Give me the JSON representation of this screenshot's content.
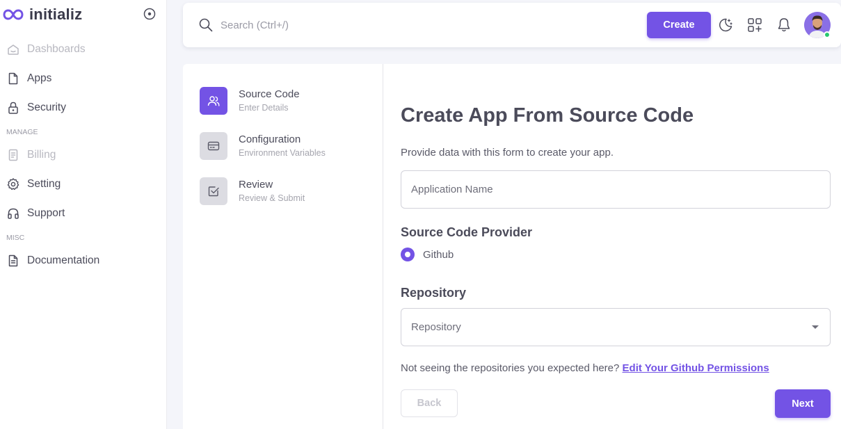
{
  "brand": {
    "name": "initializ",
    "accent": "#7353e5",
    "logo_icon": "infinity-icon"
  },
  "sidebar": {
    "items": [
      {
        "label": "Dashboards",
        "icon": "smart-home-icon",
        "disabled": true
      },
      {
        "label": "Apps",
        "icon": "file-icon",
        "disabled": false
      },
      {
        "label": "Security",
        "icon": "lock-icon",
        "disabled": false
      }
    ],
    "sections": [
      {
        "title": "MANAGE",
        "items": [
          {
            "label": "Billing",
            "icon": "file-dollar-icon",
            "disabled": true
          },
          {
            "label": "Setting",
            "icon": "gear-icon",
            "disabled": false
          },
          {
            "label": "Support",
            "icon": "headphones-icon",
            "disabled": false
          }
        ]
      },
      {
        "title": "MISC",
        "items": [
          {
            "label": "Documentation",
            "icon": "file-text-icon",
            "disabled": false
          }
        ]
      }
    ]
  },
  "header": {
    "search_placeholder": "Search (Ctrl+/)",
    "create_label": "Create",
    "icons": [
      "moon-stars-icon",
      "apps-plus-icon",
      "bell-icon"
    ],
    "user_status": "online"
  },
  "stepper": {
    "steps": [
      {
        "title": "Source Code",
        "subtitle": "Enter Details",
        "icon": "users-icon",
        "active": true
      },
      {
        "title": "Configuration",
        "subtitle": "Environment Variables",
        "icon": "credit-card-icon",
        "active": false
      },
      {
        "title": "Review",
        "subtitle": "Review & Submit",
        "icon": "checkbox-icon",
        "active": false
      }
    ]
  },
  "form": {
    "title": "Create App From Source Code",
    "description": "Provide data with this form to create your app.",
    "app_name_placeholder": "Application Name",
    "provider_label": "Source Code Provider",
    "provider_option": "Github",
    "repository_label": "Repository",
    "repository_placeholder": "Repository",
    "repo_note": "Not seeing the repositories you expected here?",
    "repo_link": "Edit Your Github Permissions",
    "back_label": "Back",
    "next_label": "Next"
  }
}
